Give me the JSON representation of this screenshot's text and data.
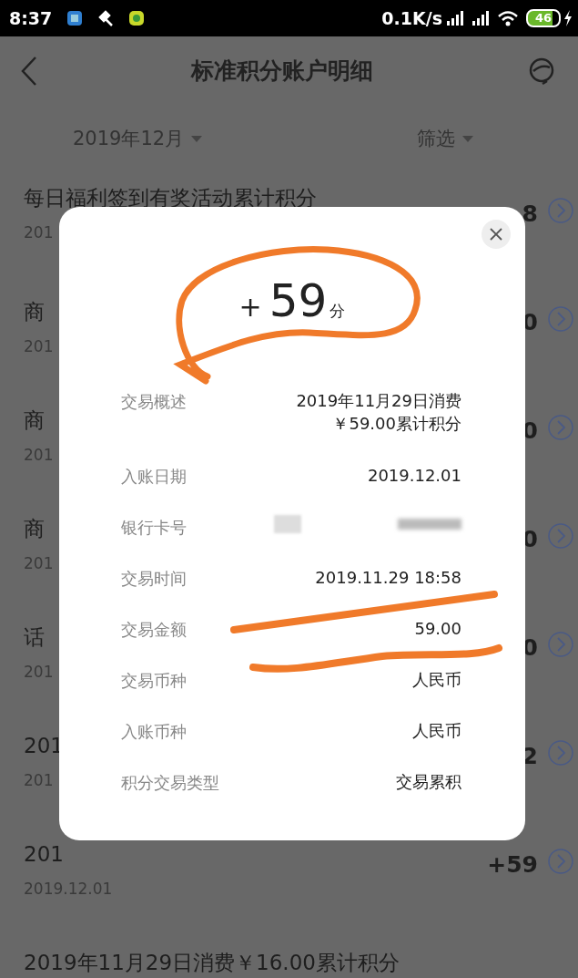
{
  "status_bar": {
    "time": "8:37",
    "network_speed": "0.1K/s",
    "battery": "46"
  },
  "header": {
    "title": "标准积分账户明细"
  },
  "filters": {
    "month": "2019年12月",
    "filter": "筛选"
  },
  "records": [
    {
      "title": "每日福利签到有奖活动累计积分",
      "date": "201",
      "amount": "8"
    },
    {
      "title": "商",
      "date": "201",
      "amount": "0"
    },
    {
      "title": "商",
      "date": "201",
      "amount": "0"
    },
    {
      "title": "商",
      "date": "201",
      "amount": "0"
    },
    {
      "title": "话",
      "date": "201",
      "amount": "0"
    },
    {
      "title": "201",
      "date": "201",
      "amount": "2"
    },
    {
      "title": "201",
      "date": "2019.12.01",
      "amount": "+59"
    },
    {
      "title": "2019年11月29日消费￥16.00累计积分"
    }
  ],
  "dialog": {
    "sign": "+",
    "points": "59",
    "unit": "分",
    "details": [
      {
        "kind": "text",
        "label": "交易概述",
        "value": "2019年11月29日消费￥59.00累计积分"
      },
      {
        "kind": "text",
        "label": "入账日期",
        "value": "2019.12.01"
      },
      {
        "kind": "blurred",
        "label": "银行卡号"
      },
      {
        "kind": "text",
        "label": "交易时间",
        "value": "2019.11.29 18:58"
      },
      {
        "kind": "text",
        "label": "交易金额",
        "value": "59.00"
      },
      {
        "kind": "text",
        "label": "交易币种",
        "value": "人民币"
      },
      {
        "kind": "text",
        "label": "入账币种",
        "value": "人民币"
      },
      {
        "kind": "text",
        "label": "积分交易类型",
        "value": "交易累积"
      }
    ]
  }
}
